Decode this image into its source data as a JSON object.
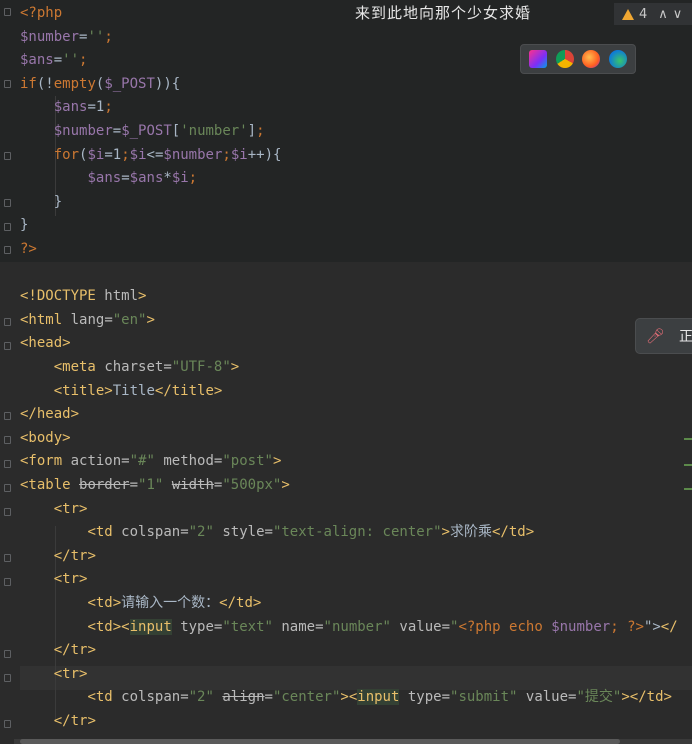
{
  "window": {
    "title": "来到此地向那个少女求婚"
  },
  "warnings": {
    "count": "4",
    "up": "^",
    "down": "v"
  },
  "float_panel": {
    "text": "正"
  },
  "code": {
    "lines": [
      "<?php",
      "$number='';",
      "$ans='';",
      "if(!empty($_POST)){",
      "    $ans=1;",
      "    $number=$_POST['number'];",
      "    for($i=1;$i<=$number;$i++){",
      "        $ans=$ans*$i;",
      "    }",
      "}",
      "?>",
      "",
      "<!DOCTYPE html>",
      "<html lang=\"en\">",
      "<head>",
      "    <meta charset=\"UTF-8\">",
      "    <title>Title</title>",
      "</head>",
      "<body>",
      "<form action=\"#\" method=\"post\">",
      "<table border=\"1\" width=\"500px\">",
      "    <tr>",
      "        <td colspan=\"2\" style=\"text-align: center\">求阶乘</td>",
      "    </tr>",
      "    <tr>",
      "        <td>请输入一个数：</td>",
      "        <td><input type=\"text\" name=\"number\" value=\"<?php echo $number; ?>\"></",
      "    </tr>",
      "    <tr>",
      "        <td colspan=\"2\" align=\"center\"><input type=\"submit\" value=\"提交\"></td>",
      "    </tr>"
    ]
  },
  "colors": {
    "background": "#2b2b2b",
    "tag": "#e8bf6a",
    "string": "#6a8759",
    "keyword": "#cc7832",
    "variable": "#9876aa",
    "text": "#a9b7c6"
  }
}
